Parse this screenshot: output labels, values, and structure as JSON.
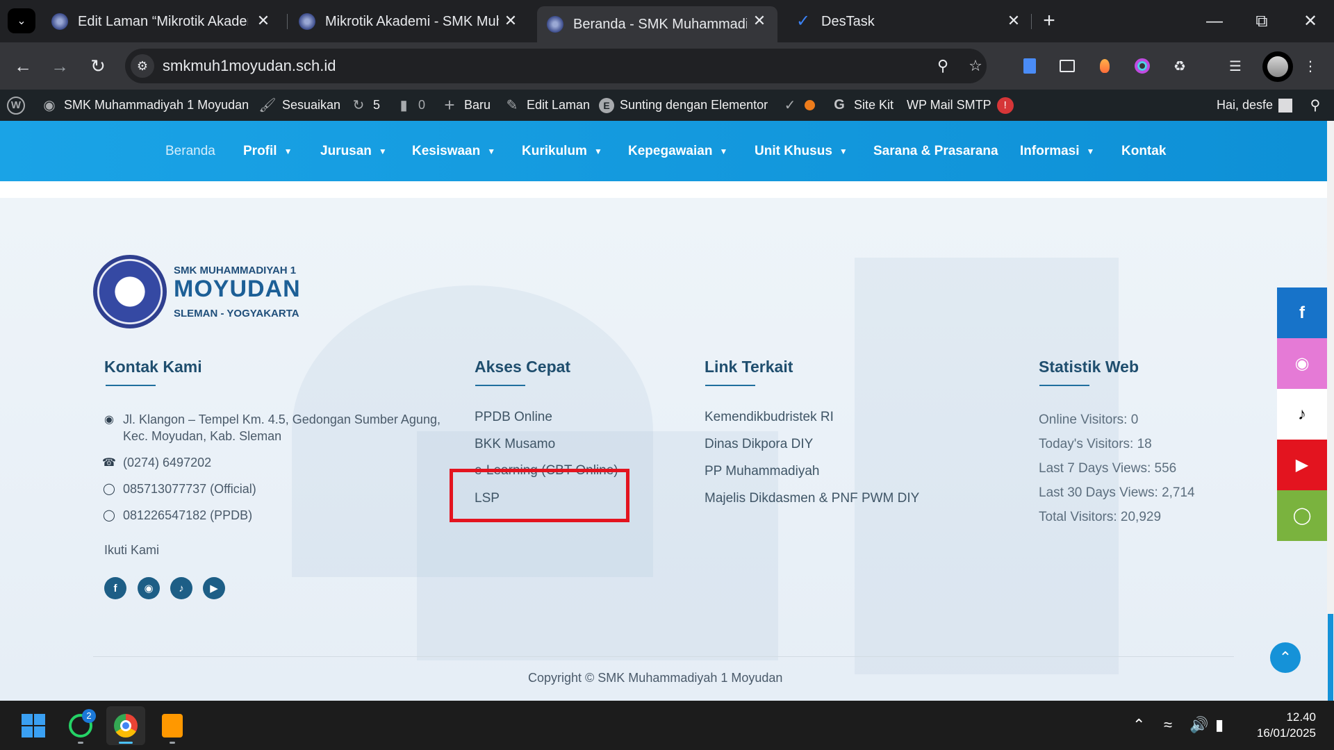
{
  "browser": {
    "tabs": [
      {
        "title": "Edit Laman “Mikrotik Akademi”",
        "active": false
      },
      {
        "title": "Mikrotik Akademi - SMK Muhammadiyah",
        "active": false
      },
      {
        "title": "Beranda - SMK Muhammadiyah",
        "active": true
      },
      {
        "title": "DesTask",
        "active": false
      }
    ],
    "url": "smkmuh1moyudan.sch.id"
  },
  "wp_admin_bar": {
    "site_name": "SMK Muhammadiyah 1 Moyudan",
    "customize": "Sesuaikan",
    "updates_count": "5",
    "comments_count": "0",
    "new": "Baru",
    "edit_page": "Edit Laman",
    "elementor": "Sunting dengan Elementor",
    "site_kit": "Site Kit",
    "wp_mail_smtp": "WP Mail SMTP",
    "smtp_badge": "!",
    "greeting": "Hai, desfe"
  },
  "site_nav": {
    "items": [
      {
        "label": "Beranda",
        "dropdown": false
      },
      {
        "label": "Profil",
        "dropdown": true
      },
      {
        "label": "Jurusan",
        "dropdown": true
      },
      {
        "label": "Kesiswaan",
        "dropdown": true
      },
      {
        "label": "Kurikulum",
        "dropdown": true
      },
      {
        "label": "Kepegawaian",
        "dropdown": true
      },
      {
        "label": "Unit Khusus",
        "dropdown": true
      },
      {
        "label": "Sarana & Prasarana",
        "dropdown": false
      },
      {
        "label": "Informasi",
        "dropdown": true
      },
      {
        "label": "Kontak",
        "dropdown": false
      }
    ]
  },
  "footer": {
    "logo": {
      "line1": "SMK MUHAMMADIYAH 1",
      "line2": "MOYUDAN",
      "line3": "SLEMAN - YOGYAKARTA"
    },
    "contact": {
      "title": "Kontak Kami",
      "address_line1": "Jl. Klangon – Tempel Km. 4.5, Gedongan Sumber Agung,",
      "address_line2": "Kec. Moyudan, Kab. Sleman",
      "phone": "(0274) 6497202",
      "wa_official": "085713077737 (Official)",
      "wa_ppdb": "081226547182 (PPDB)",
      "follow": "Ikuti Kami"
    },
    "quick_access": {
      "title": "Akses Cepat",
      "links": [
        "PPDB Online",
        "BKK Musamo",
        "e-Learning (CBT Online)",
        "LSP"
      ]
    },
    "related_links": {
      "title": "Link Terkait",
      "links": [
        "Kemendikbudristek RI",
        "Dinas Dikpora DIY",
        "PP Muhammadiyah",
        "Majelis Dikdasmen & PNF PWM DIY"
      ]
    },
    "stats": {
      "title": "Statistik Web",
      "lines": [
        "Online Visitors: 0",
        "Today's Visitors: 18",
        "Last 7 Days Views: 556",
        "Last 30 Days Views: 2,714",
        "Total Visitors: 20,929"
      ]
    },
    "copyright": "Copyright © SMK Muhammadiyah 1 Moyudan"
  },
  "share_bar": [
    "facebook-icon",
    "instagram-icon",
    "tiktok-icon",
    "youtube-icon",
    "whatsapp-icon"
  ],
  "taskbar": {
    "whatsapp_badge": "2",
    "time": "12.40",
    "date": "16/01/2025"
  },
  "colors": {
    "nav_gradient_start": "#1aa3e6",
    "nav_gradient_end": "#0e90d6",
    "title_color": "#1f4e6e",
    "highlight": "#e3141f",
    "facebook": "#1773c9",
    "instagram": "#e57ad6",
    "tiktok": "#ffffff",
    "youtube": "#e3141f",
    "whatsapp": "#7ab33e"
  }
}
